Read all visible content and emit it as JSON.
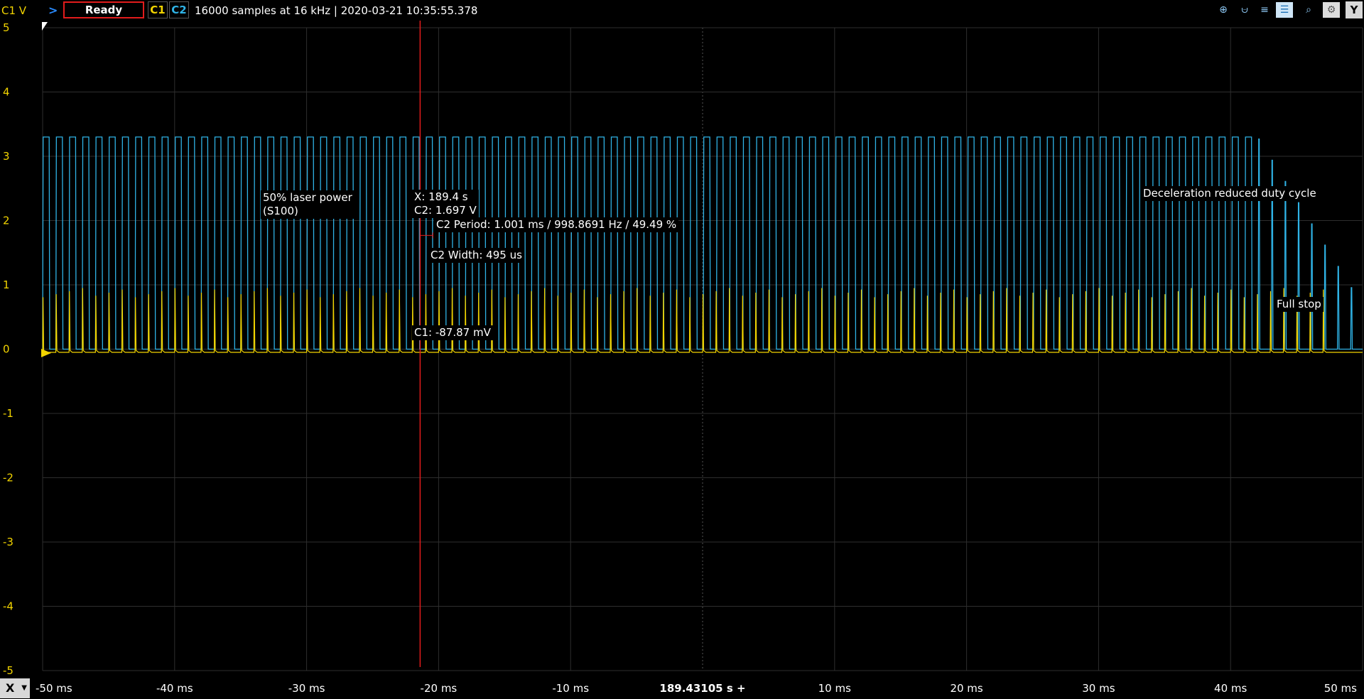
{
  "topbar": {
    "channel_unit": "C1 V",
    "arrow": ">",
    "status": "Ready",
    "c1": "C1",
    "c2": "C2",
    "info": "16000 samples at 16 kHz | 2020-03-21 10:35:55.378",
    "tools": [
      "zoom-in-icon",
      "cursor-horizontal-icon",
      "cursor-vertical-icon",
      "cursor-xy-icon",
      "magnifier-icon",
      "settings-gear-icon"
    ],
    "y_button": "Y"
  },
  "bottombar": {
    "x_button": "X",
    "center_time": "189.43105 s +"
  },
  "annotations": {
    "laser_line1": "50% laser power",
    "laser_line2": "(S100)",
    "cursor_x": "X: 189.4 s",
    "cursor_c2": "C2: 1.697 V",
    "c2_period": "C2 Period: 1.001 ms / 998.8691 Hz / 49.49 %",
    "c2_width": "C2 Width: 495 us",
    "cursor_c1": "C1: -87.87 mV",
    "decel": "Deceleration reduced duty cycle",
    "full_stop": "Full stop"
  },
  "colors": {
    "c1": "#f2d400",
    "c2": "#2fb3e6",
    "cursor": "#e21c1c",
    "grid": "#333333"
  },
  "chart_data": {
    "type": "line",
    "x_unit": "ms",
    "y_unit": "V",
    "xlim": [
      -50,
      50
    ],
    "ylim": [
      -5,
      5
    ],
    "x_ticks": [
      "-50 ms",
      "-40 ms",
      "-30 ms",
      "-20 ms",
      "-10 ms",
      "10 ms",
      "20 ms",
      "30 ms",
      "40 ms",
      "50 ms"
    ],
    "y_ticks": [
      "5",
      "4",
      "3",
      "2",
      "1",
      "0",
      "-1",
      "-2",
      "-3",
      "-4",
      "-5"
    ],
    "grid": true,
    "cursor_x_ms": -21.4,
    "series": [
      {
        "name": "C1",
        "description_values": {
          "pulse_period_ms": 1.0,
          "pulse_peak_v": 0.95,
          "baseline_v": -0.05,
          "end_ms": 48
        }
      },
      {
        "name": "C2",
        "description_values": {
          "period_ms": 1.001,
          "duty_pct": 49.49,
          "high_v": 3.3,
          "low_v": 0.0,
          "decel_start_ms": 42,
          "end_ms": 50
        }
      }
    ]
  }
}
